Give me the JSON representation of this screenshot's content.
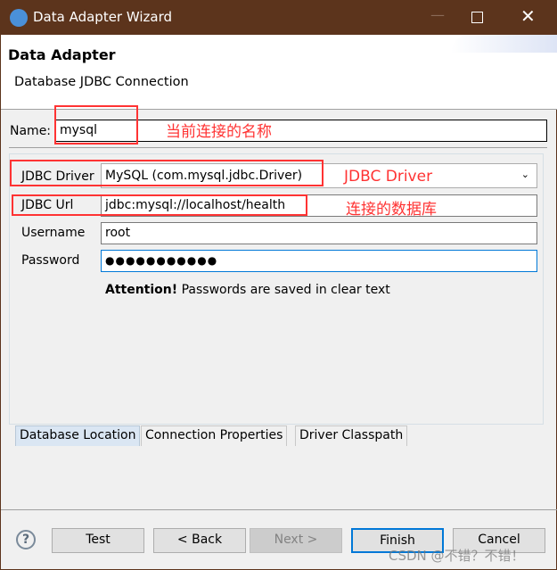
{
  "window": {
    "title": "Data Adapter Wizard"
  },
  "header": {
    "title": "Data Adapter",
    "subtitle": "Database JDBC Connection"
  },
  "form": {
    "name_label": "Name:",
    "name_value": "mysql",
    "driver_label": "JDBC Driver",
    "driver_value": "MySQL (com.mysql.jdbc.Driver)",
    "url_label": "JDBC Url",
    "url_value": "jdbc:mysql://localhost/health",
    "username_label": "Username",
    "username_value": "root",
    "password_label": "Password",
    "password_value": "●●●●●●●●●●●",
    "attention_bold": "Attention!",
    "attention_text": " Passwords are saved in clear text"
  },
  "annotations": {
    "name": "当前连接的名称",
    "driver": "JDBC Driver",
    "url": "连接的数据库"
  },
  "tabs": [
    {
      "label": "Database Location",
      "active": true
    },
    {
      "label": "Connection Properties"
    },
    {
      "label": "Driver Classpath"
    }
  ],
  "buttons": {
    "test": "Test",
    "back": "< Back",
    "next": "Next >",
    "finish": "Finish",
    "cancel": "Cancel"
  },
  "watermark": "CSDN @不错？不错！"
}
